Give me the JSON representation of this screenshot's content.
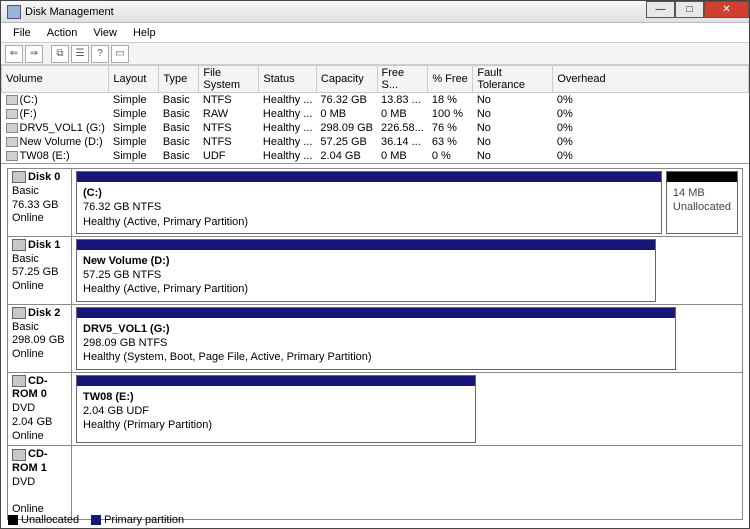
{
  "window": {
    "title": "Disk Management"
  },
  "menu": {
    "file": "File",
    "action": "Action",
    "view": "View",
    "help": "Help"
  },
  "grid": {
    "headers": {
      "volume": "Volume",
      "layout": "Layout",
      "type": "Type",
      "fs": "File System",
      "status": "Status",
      "capacity": "Capacity",
      "free": "Free S...",
      "pctfree": "% Free",
      "fault": "Fault Tolerance",
      "overhead": "Overhead"
    },
    "rows": [
      {
        "volume": "(C:)",
        "layout": "Simple",
        "type": "Basic",
        "fs": "NTFS",
        "status": "Healthy ...",
        "capacity": "76.32 GB",
        "free": "13.83 ...",
        "pctfree": "18 %",
        "fault": "No",
        "overhead": "0%"
      },
      {
        "volume": "(F:)",
        "layout": "Simple",
        "type": "Basic",
        "fs": "RAW",
        "status": "Healthy ...",
        "capacity": "0 MB",
        "free": "0 MB",
        "pctfree": "100 %",
        "fault": "No",
        "overhead": "0%"
      },
      {
        "volume": "DRV5_VOL1 (G:)",
        "layout": "Simple",
        "type": "Basic",
        "fs": "NTFS",
        "status": "Healthy ...",
        "capacity": "298.09 GB",
        "free": "226.58...",
        "pctfree": "76 %",
        "fault": "No",
        "overhead": "0%"
      },
      {
        "volume": "New Volume (D:)",
        "layout": "Simple",
        "type": "Basic",
        "fs": "NTFS",
        "status": "Healthy ...",
        "capacity": "57.25 GB",
        "free": "36.14 ...",
        "pctfree": "63 %",
        "fault": "No",
        "overhead": "0%"
      },
      {
        "volume": "TW08 (E:)",
        "layout": "Simple",
        "type": "Basic",
        "fs": "UDF",
        "status": "Healthy ...",
        "capacity": "2.04 GB",
        "free": "0 MB",
        "pctfree": "0 %",
        "fault": "No",
        "overhead": "0%"
      }
    ]
  },
  "disks": [
    {
      "name": "Disk 0",
      "kind": "Basic",
      "size": "76.33 GB",
      "state": "Online",
      "parts": [
        {
          "label": " (C:)",
          "sub": "76.32 GB NTFS",
          "status": "Healthy (Active, Primary Partition)",
          "flex": "1",
          "type": "primary"
        },
        {
          "label": "",
          "sub": "14 MB",
          "status": "Unallocated",
          "flex": "0 0 70px",
          "type": "unalloc"
        }
      ]
    },
    {
      "name": "Disk 1",
      "kind": "Basic",
      "size": "57.25 GB",
      "state": "Online",
      "parts": [
        {
          "label": "New Volume  (D:)",
          "sub": "57.25 GB NTFS",
          "status": "Healthy (Active, Primary Partition)",
          "flex": "0 0 580px",
          "type": "primary"
        }
      ]
    },
    {
      "name": "Disk 2",
      "kind": "Basic",
      "size": "298.09 GB",
      "state": "Online",
      "parts": [
        {
          "label": "DRV5_VOL1  (G:)",
          "sub": "298.09 GB NTFS",
          "status": "Healthy (System, Boot, Page File, Active, Primary Partition)",
          "flex": "0 0 600px",
          "type": "primary"
        }
      ]
    },
    {
      "name": "CD-ROM 0",
      "kind": "DVD",
      "size": "2.04 GB",
      "state": "Online",
      "parts": [
        {
          "label": "TW08  (E:)",
          "sub": "2.04 GB UDF",
          "status": "Healthy (Primary Partition)",
          "flex": "0 0 400px",
          "type": "primary"
        }
      ]
    },
    {
      "name": "CD-ROM 1",
      "kind": "DVD",
      "size": "",
      "state": "Online",
      "parts": []
    }
  ],
  "legend": {
    "unallocated": "Unallocated",
    "primary": "Primary partition"
  }
}
